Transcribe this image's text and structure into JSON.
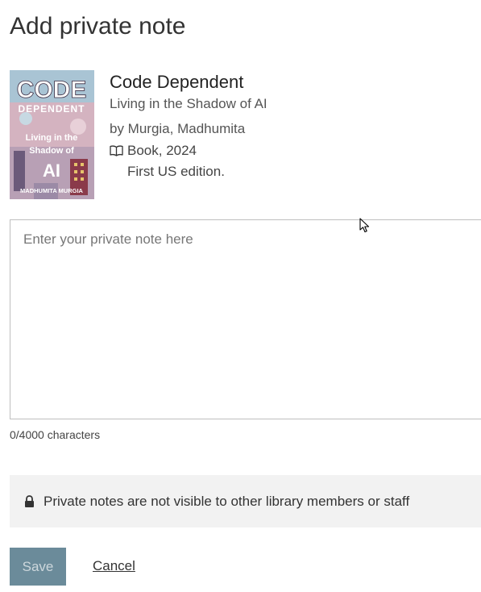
{
  "page": {
    "title": "Add private note"
  },
  "book": {
    "title": "Code Dependent",
    "subtitle": "Living in the Shadow of AI",
    "author": "by Murgia, Madhumita",
    "format": "Book, 2024",
    "edition": "First US edition.",
    "cover": {
      "line1": "CODE",
      "line2": "DEPENDENT",
      "line3": "Living in the",
      "line4": "Shadow of",
      "line5": "AI",
      "line6": "MADHUMITA MURGIA"
    }
  },
  "note": {
    "value": "",
    "placeholder": "Enter your private note here",
    "char_count": "0/4000 characters"
  },
  "info": {
    "icon": "lock-icon",
    "text": "Private notes are not visible to other library members or staff"
  },
  "actions": {
    "save_label": "Save",
    "cancel_label": "Cancel"
  },
  "colors": {
    "save_bg": "#6b8b9a",
    "info_bg": "#f2f2f2",
    "border": "#bfbfbf"
  }
}
